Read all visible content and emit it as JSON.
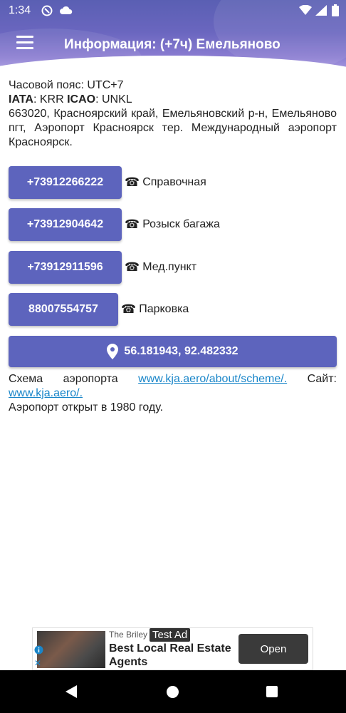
{
  "status_bar": {
    "time": "1:34"
  },
  "app_bar": {
    "title": "Информация: (+7ч) Емельяново"
  },
  "info": {
    "timezone": "Часовой пояс: UTC+7",
    "iata_label": "IATA",
    "iata_value": ": KRR ",
    "icao_label": "ICAO",
    "icao_value": ": UNKL",
    "address": "663020, Красноярский край, Емельяновский р-н, Емельяново пгт, Аэропорт Красноярск тер. Международный аэропорт Красноярск."
  },
  "phones": [
    {
      "number": "+73912266222",
      "label": "Справочная"
    },
    {
      "number": "+73912904642",
      "label": "Розыск багажа"
    },
    {
      "number": "+73912911596",
      "label": "Мед.пункт"
    },
    {
      "number": "88007554757",
      "label": "Парковка"
    }
  ],
  "phone_icon_glyph": "☎",
  "coordinates": "56.181943, 92.482332",
  "footer": {
    "scheme_text": "Схема аэропорта",
    "scheme_link": "www.kja.aero/about/scheme/.",
    "site_text": "Сайт:",
    "site_link": "www.kja.aero/.",
    "opened": "Аэропорт открыт в 1980 году."
  },
  "ad": {
    "brand": "The Briley",
    "badge": "Test Ad",
    "headline": "Best Local Real Estate Agents",
    "cta": "Open"
  },
  "colors": {
    "accent": "#5d64bd",
    "link": "#1a86c9"
  }
}
